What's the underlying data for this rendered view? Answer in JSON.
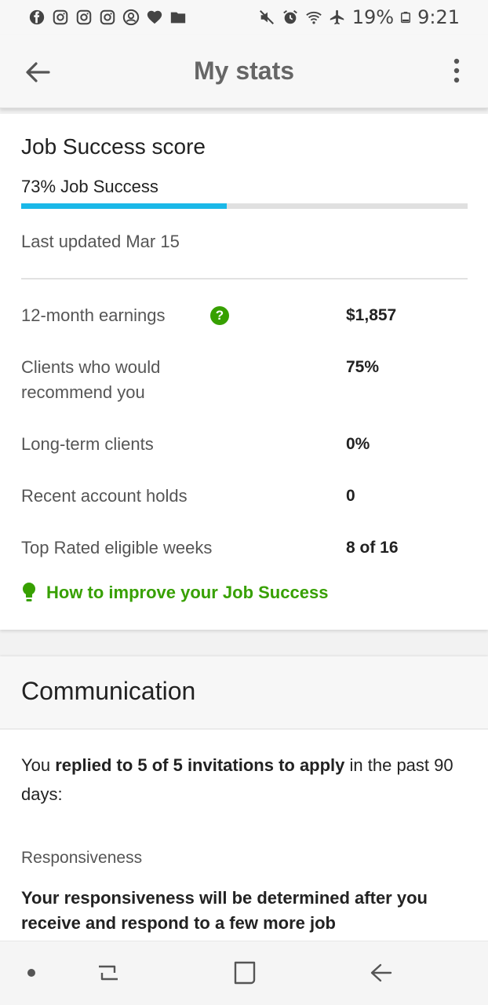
{
  "status_bar": {
    "battery": "19%",
    "time": "9:21",
    "left_icons": [
      "facebook-icon",
      "instagram-icon",
      "instagram-icon",
      "instagram-icon",
      "account-icon",
      "heart-icon",
      "folder-icon"
    ],
    "right_icons": [
      "mute-icon",
      "alarm-icon",
      "wifi-icon",
      "airplane-icon",
      "battery-icon"
    ]
  },
  "app_bar": {
    "title": "My stats"
  },
  "job_success": {
    "title": "Job Success score",
    "label": "73% Job Success",
    "percent": 0.46,
    "last_updated": "Last updated Mar 15"
  },
  "stats": [
    {
      "label": "12-month earnings",
      "value": "$1,857"
    },
    {
      "label": "Clients who would\nrecommend you",
      "value": "75%"
    },
    {
      "label": "Long-term clients",
      "value": "0%"
    },
    {
      "label": "Recent account holds",
      "value": "0"
    },
    {
      "label": "Top Rated eligible weeks",
      "value": "8 of 16"
    }
  ],
  "help_glyph": "?",
  "improve_link": "How to improve your Job Success",
  "communication": {
    "title": "Communication",
    "replied_prefix": "You ",
    "replied_bold": "replied to 5 of 5 invitations to apply",
    "replied_suffix": " in the past 90 days:",
    "responsiveness_label": "Responsiveness",
    "responsiveness_text": "Your responsiveness will be determined after you receive and respond to a few more job"
  },
  "colors": {
    "accent_green": "#37a000",
    "progress_blue": "#1ab8e8"
  }
}
